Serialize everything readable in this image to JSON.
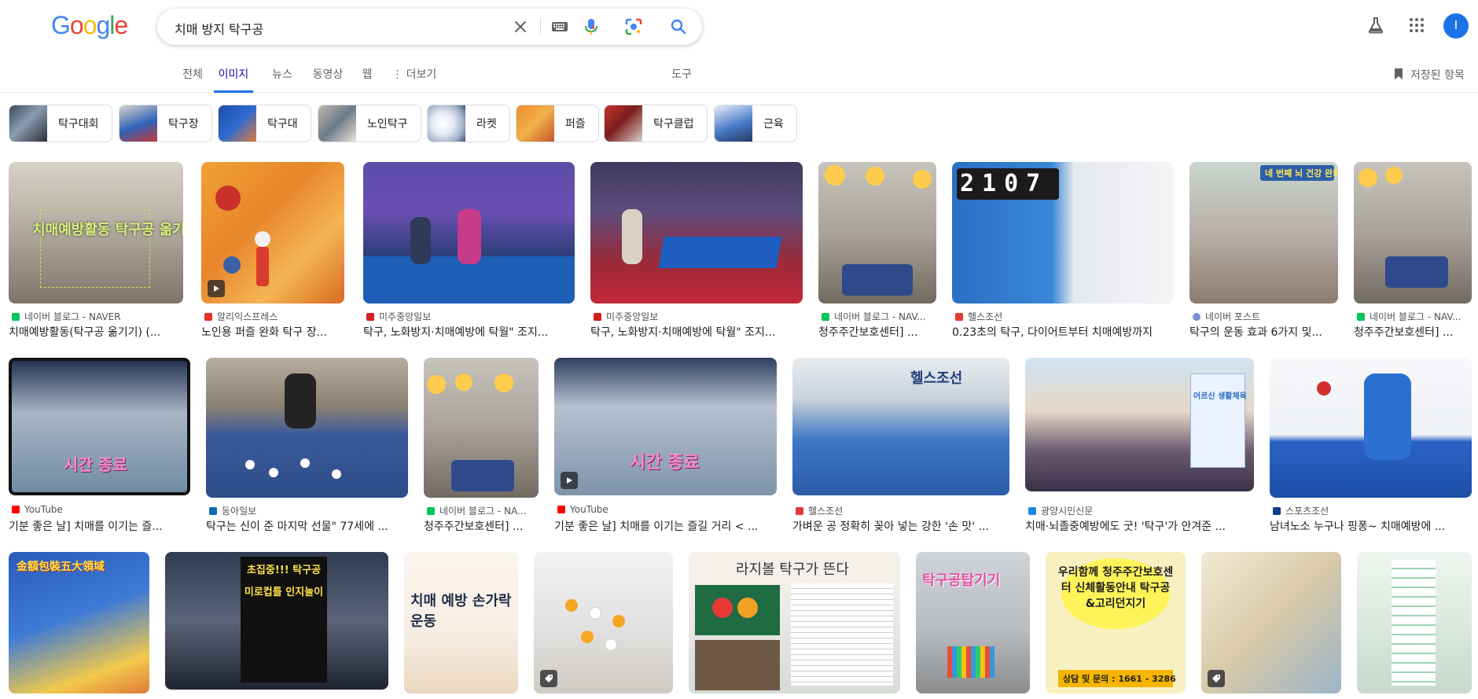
{
  "logo": {
    "letters": [
      "G",
      "o",
      "o",
      "g",
      "l",
      "e"
    ]
  },
  "search": {
    "query": "치매 방지 탁구공"
  },
  "user": {
    "avatar_letter": "I"
  },
  "tabs": [
    {
      "label": "전체"
    },
    {
      "label": "이미지"
    },
    {
      "label": "뉴스"
    },
    {
      "label": "동영상"
    },
    {
      "label": "웹"
    },
    {
      "label": "더보기"
    }
  ],
  "tools_label": "도구",
  "saved_label": "저장된 항목",
  "chips": [
    {
      "label": "탁구대회"
    },
    {
      "label": "탁구장"
    },
    {
      "label": "탁구대"
    },
    {
      "label": "노인탁구"
    },
    {
      "label": "라켓"
    },
    {
      "label": "퍼즐"
    },
    {
      "label": "탁구클럽"
    },
    {
      "label": "근육"
    }
  ],
  "results_row1": [
    {
      "source": "네이버 블로그 - NAVER",
      "title": "치매예방활동(탁구공 옮기기) (...",
      "overlay": "치매예방활동 탁구공 옮기기"
    },
    {
      "source": "알리익스프레스",
      "title": "노인용 퍼즐 완화 탁구 장..."
    },
    {
      "source": "미주중앙일보",
      "title": "탁구, 노화방지·치매예방에 탁월\" 조지..."
    },
    {
      "source": "미주중앙일보",
      "title": "탁구, 노화방지·치매예방에 탁월\" 조지..."
    },
    {
      "source": "네이버 블로그 - NAV...",
      "title": "청주주간보호센터] ..."
    },
    {
      "source": "헬스조선",
      "title": "0.23초의 탁구, 다이어트부터 치매예방까지",
      "overlay": "2107"
    },
    {
      "source": "네이버 포스트",
      "title": "탁구의 운동 효과 6가지 및...",
      "overlay": "네 번째 뇌 건강 완화"
    },
    {
      "source": "네이버 블로그 - NAV...",
      "title": "청주주간보호센터] ..."
    }
  ],
  "results_row2": [
    {
      "source": "YouTube",
      "title": "기분 좋은 날] 치매를 이기는 즐...",
      "overlay": "시간 종료"
    },
    {
      "source": "동아일보",
      "title": "탁구는 신이 준 마지막 선물\" 77세에 ..."
    },
    {
      "source": "네이버 블로그 - NA...",
      "title": "청주주간보호센터] ..."
    },
    {
      "source": "YouTube",
      "title": "기분 좋은 날] 치매를 이기는 즐길 거리 < ...",
      "overlay": "시간 종료"
    },
    {
      "source": "헬스조선",
      "title": "가벼운 공 정확히 꽂아 넣는 강한 '손 맛' ...",
      "overlay": "헬스조선"
    },
    {
      "source": "광양시민신문",
      "title": "치매·뇌졸중예방에도 굿! '탁구'가 안겨준 ...",
      "overlay": "어르신 생활체육"
    },
    {
      "source": "스포츠조선",
      "title": "남녀노소 누구나 핑퐁~ 치매예방에 ..."
    }
  ],
  "results_row3": [
    {
      "overlay": "金額包裝五大領域"
    },
    {
      "overlay": "초집중!!! 탁구공 미로컵틀 인지놀이"
    },
    {
      "overlay": "치매 예방 손가락 운동"
    },
    {
      "overlay": ""
    },
    {
      "overlay": "라지볼 탁구가 뜬다"
    },
    {
      "overlay": "탁구공탑기기"
    },
    {
      "overlay": "우리함께 청주주간보호센터 신체활동안내 탁구공&고리던지기",
      "overlay_sub": "상담 및 문의 : 1661 - 3286"
    },
    {
      "overlay": ""
    },
    {
      "overlay": ""
    }
  ],
  "colors": {
    "accent_blue": "#1a73e8",
    "link_purple": "#1a0dab",
    "text_secondary": "#5f6368"
  }
}
